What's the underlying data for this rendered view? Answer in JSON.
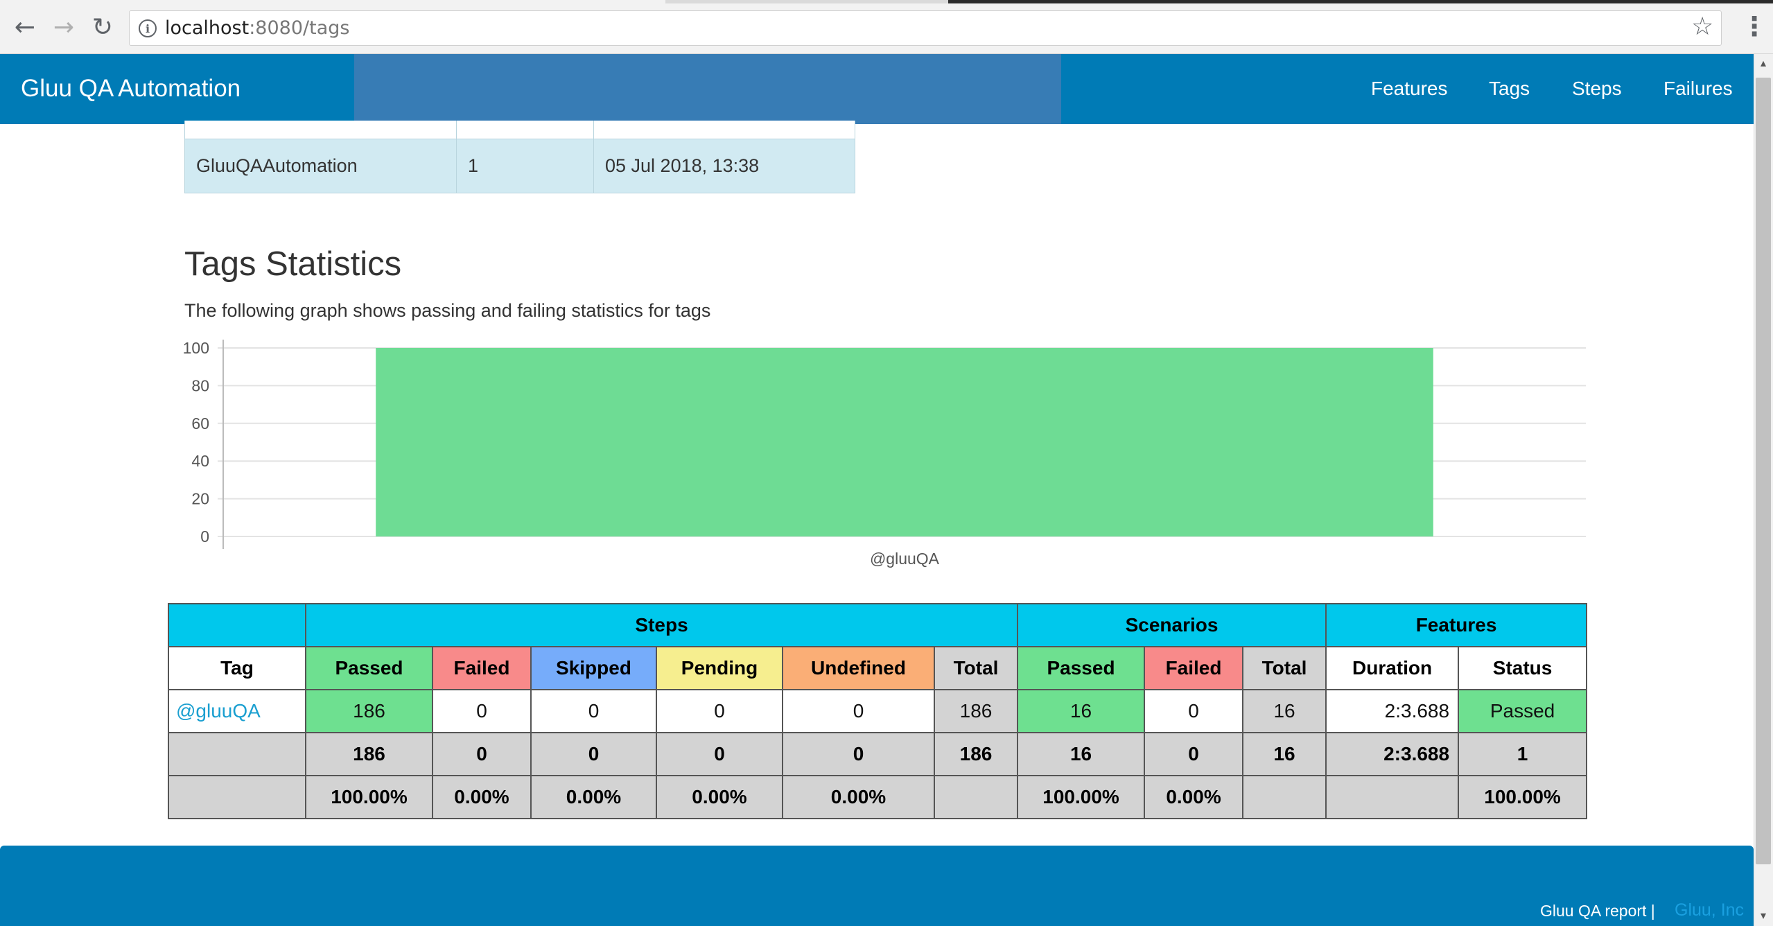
{
  "browser": {
    "url_host": "localhost",
    "url_rest": ":8080/tags"
  },
  "icons": {
    "back": "←",
    "forward": "→",
    "reload": "↻",
    "info": "i",
    "star": "☆",
    "menu": "⋮",
    "scroll_up": "▴",
    "scroll_down": "▾"
  },
  "navbar": {
    "brand": "Gluu QA Automation",
    "links": [
      "Features",
      "Tags",
      "Steps",
      "Failures"
    ]
  },
  "top_table": {
    "row": [
      "GluuQAAutomation",
      "1",
      "05 Jul 2018, 13:38"
    ]
  },
  "section": {
    "title": "Tags Statistics",
    "description": "The following graph shows passing and failing statistics for tags"
  },
  "chart_data": {
    "type": "bar",
    "categories": [
      "@gluuQA"
    ],
    "series": [
      {
        "values": [
          100
        ],
        "color": "#6edc94"
      }
    ],
    "ylim": [
      0,
      100
    ],
    "yticks": [
      0,
      20,
      40,
      60,
      80,
      100
    ],
    "grid": true,
    "title": "",
    "xlabel": "",
    "ylabel": ""
  },
  "stats": {
    "groups": [
      "Steps",
      "Scenarios",
      "Features"
    ],
    "columns": [
      "Tag",
      "Passed",
      "Failed",
      "Skipped",
      "Pending",
      "Undefined",
      "Total",
      "Passed",
      "Failed",
      "Total",
      "Duration",
      "Status"
    ],
    "row": {
      "tag": "@gluuQA",
      "values": [
        "186",
        "0",
        "0",
        "0",
        "0",
        "186",
        "16",
        "0",
        "16",
        "2:3.688",
        "Passed"
      ]
    },
    "totals": [
      "186",
      "0",
      "0",
      "0",
      "0",
      "186",
      "16",
      "0",
      "16",
      "2:3.688",
      "1"
    ],
    "percentages": [
      "100.00%",
      "0.00%",
      "0.00%",
      "0.00%",
      "0.00%",
      "",
      "100.00%",
      "0.00%",
      "",
      "",
      "100.00%"
    ]
  },
  "footer": {
    "text": "Gluu QA report |",
    "link": "Gluu, Inc"
  }
}
